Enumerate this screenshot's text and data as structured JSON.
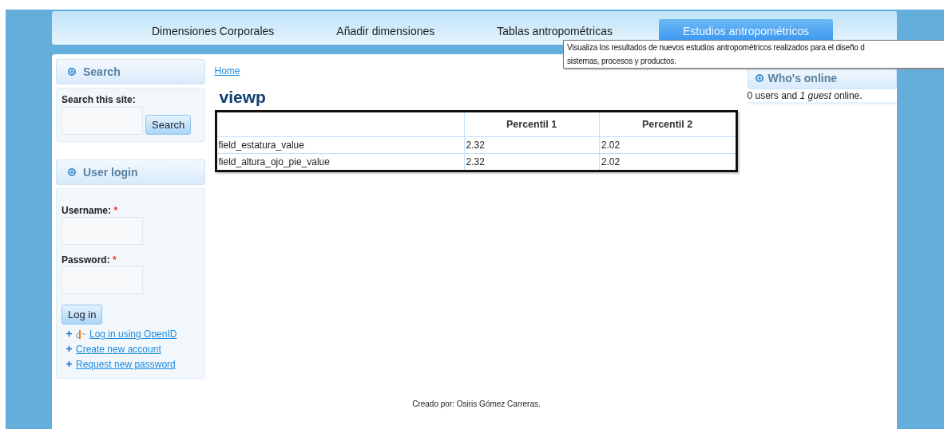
{
  "nav": {
    "tabs": [
      {
        "label": "Dimensiones Corporales",
        "selected": false
      },
      {
        "label": "Añadir dimensiones",
        "selected": false
      },
      {
        "label": "Tablas antropométricas",
        "selected": false
      },
      {
        "label": "Estudios antropométricos",
        "selected": true
      }
    ],
    "tooltip_lines": [
      "Visualiza los resultados de nuevos estudios antropométricos realizados para el diseño d",
      "sistemas, procesos y productos."
    ]
  },
  "sidebar": {
    "search": {
      "title": "Search",
      "label": "Search this site:",
      "button": "Search"
    },
    "login": {
      "title": "User login",
      "username_label": "Username:",
      "password_label": "Password:",
      "required_mark": "*",
      "button": "Log in",
      "links": [
        {
          "kind": "openid",
          "label": "Log in using OpenID"
        },
        {
          "kind": "plain",
          "label": "Create new account"
        },
        {
          "kind": "plain",
          "label": "Request new password"
        }
      ]
    }
  },
  "breadcrumb": "Home",
  "title": "viewp",
  "table": {
    "columns": [
      "Percentil 1",
      "Percentil 2"
    ],
    "rows": [
      {
        "field": "field_estatura_value",
        "values": [
          "2.32",
          "2.02"
        ]
      },
      {
        "field": "field_altura_ojo_pie_value",
        "values": [
          "2.32",
          "2.02"
        ]
      }
    ]
  },
  "whos_online": {
    "title": "Who's online",
    "text": "0 users and *1 guest* online."
  },
  "footer": "Creado por: Osiris Gómez Carreras."
}
